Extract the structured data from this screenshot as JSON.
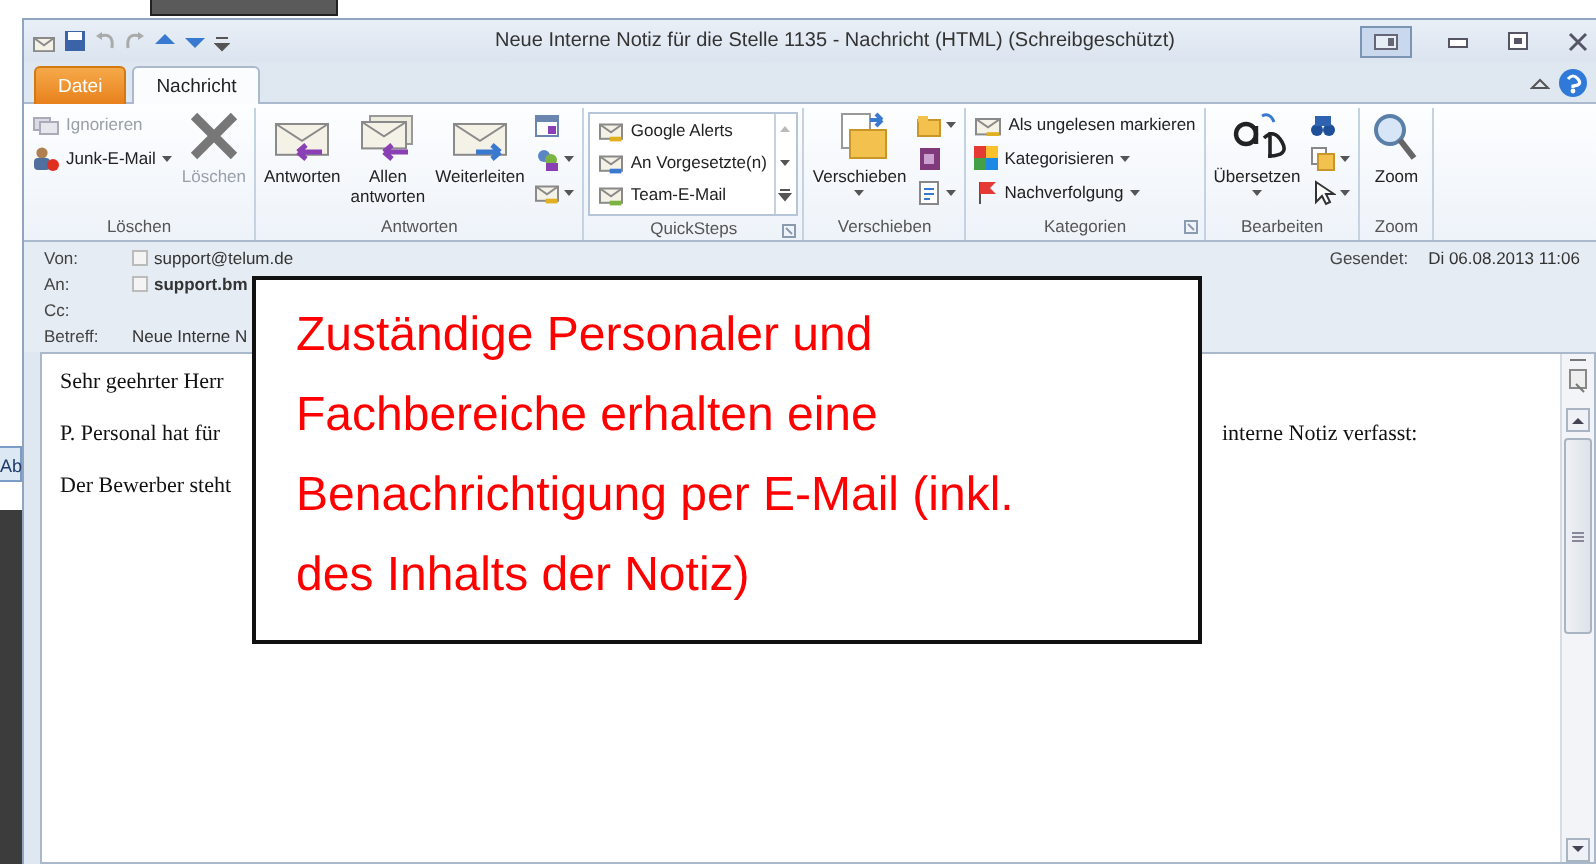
{
  "background": {
    "button_label": "Ab"
  },
  "window": {
    "title": "Neue Interne Notiz für die Stelle 1135  - Nachricht (HTML) (Schreibgeschützt)"
  },
  "tabs": [
    {
      "label": "Datei",
      "kind": "file",
      "selected": false
    },
    {
      "label": "Nachricht",
      "kind": "tab",
      "selected": true
    }
  ],
  "ribbon_groups": [
    {
      "label": "Löschen",
      "kind": "buttons",
      "launcher": false,
      "columns": [
        [
          {
            "kind": "small",
            "label": "Ignorieren",
            "disabled": true
          },
          {
            "kind": "small_menu",
            "label": "Junk-E-Mail",
            "disabled": false
          }
        ],
        [
          {
            "kind": "large",
            "label": "Löschen",
            "disabled": true
          }
        ]
      ]
    },
    {
      "label": "Antworten",
      "kind": "buttons",
      "launcher": false,
      "columns": [
        [
          {
            "kind": "large",
            "label": "Antworten",
            "disabled": false
          }
        ],
        [
          {
            "kind": "large",
            "label": "Allen\nantworten",
            "disabled": false
          }
        ],
        [
          {
            "kind": "large",
            "label": "Weiterleiten",
            "disabled": false
          }
        ],
        [
          {
            "kind": "icon",
            "disabled": false
          },
          {
            "kind": "icon_menu",
            "disabled": false
          },
          {
            "kind": "icon_menu",
            "disabled": false
          }
        ]
      ]
    },
    {
      "label": "QuickSteps",
      "kind": "quicksteps",
      "launcher": true,
      "columns": [
        [
          {
            "label": "Google Alerts"
          },
          {
            "label": "An Vorgesetzte(n)"
          },
          {
            "label": "Team-E-Mail"
          }
        ]
      ]
    },
    {
      "label": "Verschieben",
      "kind": "buttons",
      "launcher": false,
      "columns": [
        [
          {
            "kind": "large_menu",
            "label": "Verschieben",
            "disabled": false
          }
        ],
        [
          {
            "kind": "icon_menu",
            "disabled": false
          },
          {
            "kind": "icon",
            "disabled": false
          },
          {
            "kind": "icon_menu",
            "disabled": false
          }
        ]
      ]
    },
    {
      "label": "Kategorien",
      "kind": "buttons",
      "launcher": true,
      "columns": [
        [
          {
            "kind": "small",
            "label": "Als ungelesen markieren",
            "disabled": false
          },
          {
            "kind": "small_menu",
            "label": "Kategorisieren",
            "disabled": false
          },
          {
            "kind": "small_menu",
            "label": "Nachverfolgung",
            "disabled": false
          }
        ]
      ]
    },
    {
      "label": "Bearbeiten",
      "kind": "buttons",
      "launcher": false,
      "columns": [
        [
          {
            "kind": "large_menu",
            "label": "Übersetzen",
            "disabled": false
          }
        ],
        [
          {
            "kind": "icon",
            "disabled": false
          },
          {
            "kind": "icon_menu",
            "disabled": false
          },
          {
            "kind": "icon_menu",
            "disabled": false
          }
        ]
      ]
    },
    {
      "label": "Zoom",
      "kind": "buttons",
      "launcher": false,
      "columns": [
        [
          {
            "kind": "large",
            "label": "Zoom",
            "disabled": false
          }
        ]
      ]
    }
  ],
  "header": {
    "fields": [
      {
        "kind": "address",
        "label": "Von:",
        "value": "support@telum.de",
        "bold": false
      },
      {
        "kind": "address",
        "label": "An:",
        "value": "support.bm",
        "bold": true
      },
      {
        "kind": "plain",
        "label": "Cc:"
      },
      {
        "kind": "plain",
        "label": "Betreff:",
        "value": "Neue Interne N",
        "bold": false
      }
    ],
    "sent": {
      "label": "Gesendet:",
      "value": "Di 06.08.2013 11:06"
    }
  },
  "body": {
    "lines": [
      {
        "left": "Sehr geehrter Herr"
      },
      {
        "left": "P. Personal hat für",
        "right": "interne Notiz verfasst:"
      },
      {
        "left": "Der Bewerber steht"
      }
    ]
  },
  "callout": {
    "lines": [
      "Zuständige Personaler und",
      "Fachbereiche erhalten eine",
      "Benachrichtigung per E-Mail (inkl.",
      "des Inhalts der Notiz)"
    ]
  }
}
